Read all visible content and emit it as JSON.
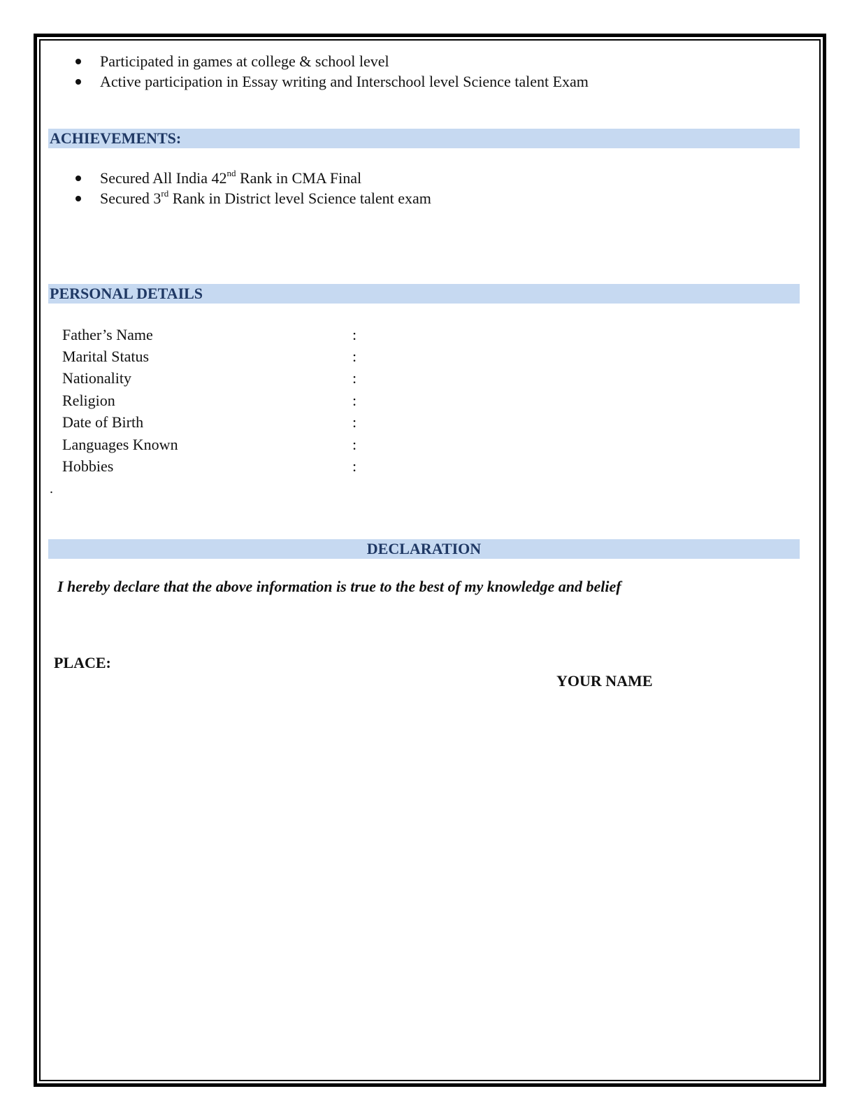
{
  "extracurricular": {
    "items": [
      "Participated in games at college & school level",
      "Active participation in Essay writing and Interschool level Science talent Exam"
    ]
  },
  "achievements": {
    "title": "ACHIEVEMENTS:",
    "items": [
      {
        "before": "Secured All India 42",
        "sup": "nd",
        "after": " Rank in CMA Final"
      },
      {
        "before": "Secured 3",
        "sup": "rd",
        "after": " Rank in District level Science talent exam"
      }
    ]
  },
  "personal_details": {
    "title": "PERSONAL DETAILS",
    "separator": ":",
    "fields": [
      {
        "label": "Father’s Name",
        "value": ""
      },
      {
        "label": "Marital Status",
        "value": ""
      },
      {
        "label": "Nationality",
        "value": ""
      },
      {
        "label": "Religion",
        "value": ""
      },
      {
        "label": "Date of Birth",
        "value": ""
      },
      {
        "label": "Languages Known",
        "value": ""
      },
      {
        "label": "Hobbies",
        "value": ""
      }
    ],
    "trailing_mark": "."
  },
  "declaration": {
    "title": "DECLARATION",
    "text": "I hereby declare that the above information is true to the best of my knowledge and belief",
    "place_label": "PLACE:",
    "signature_name": "YOUR NAME"
  },
  "colors": {
    "section_bar": "#c6d9f1",
    "section_title": "#1f3864",
    "border": "#000000"
  }
}
